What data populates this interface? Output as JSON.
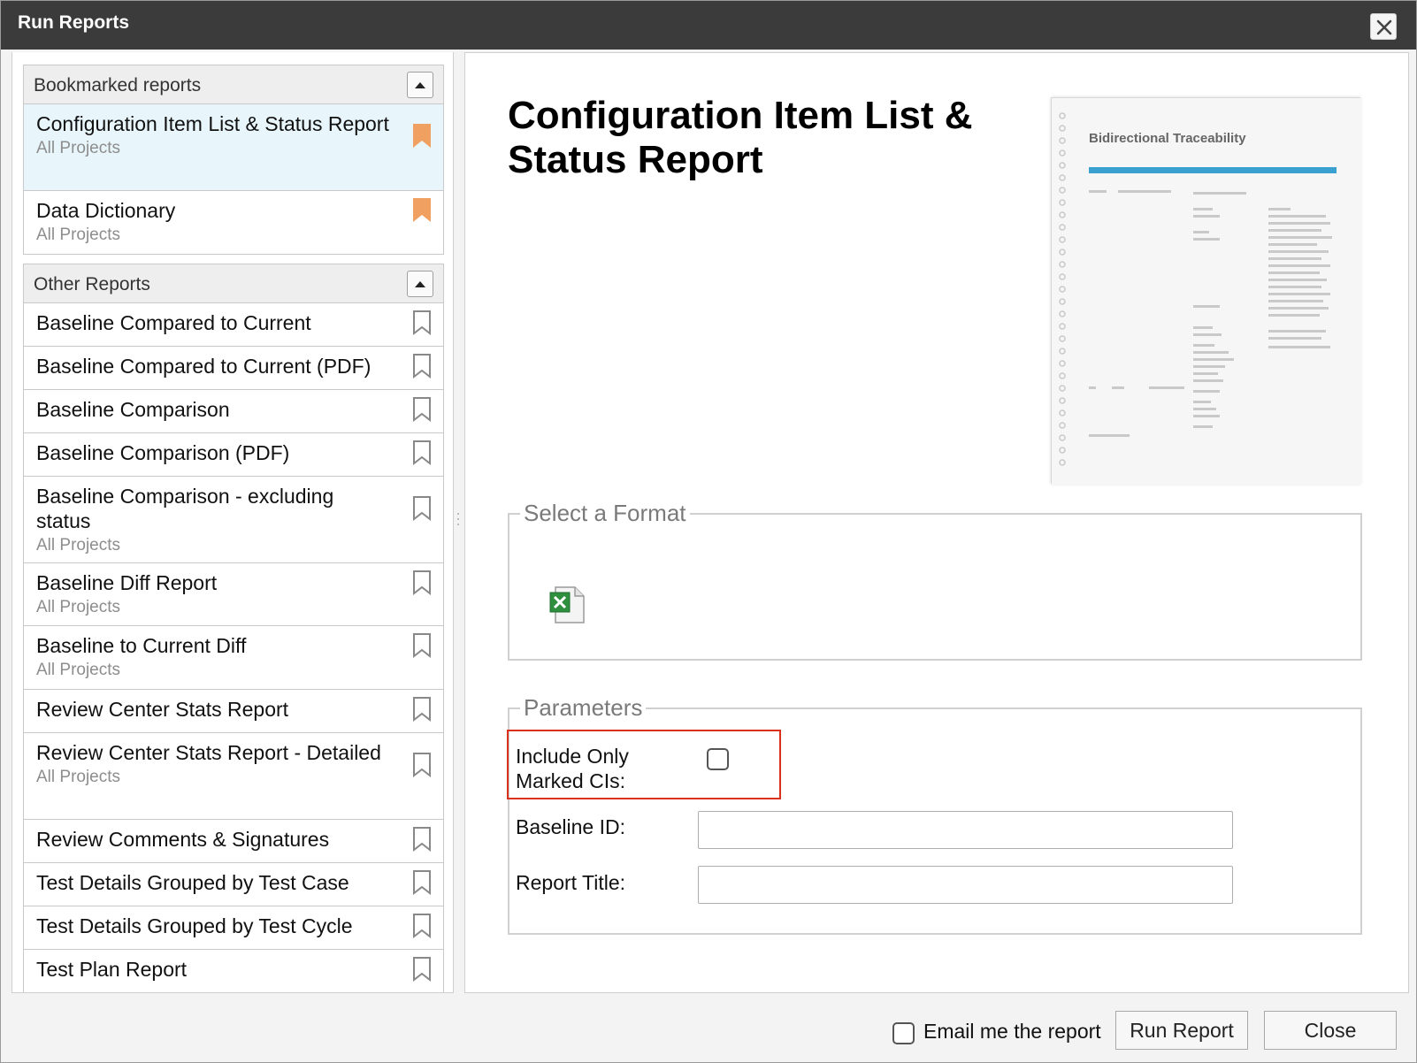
{
  "dialog": {
    "title": "Run Reports"
  },
  "bookmarked": {
    "header": "Bookmarked reports",
    "items": [
      {
        "name": "Configuration Item List & Status Report",
        "sub": "All Projects"
      },
      {
        "name": "Data Dictionary",
        "sub": "All Projects"
      }
    ]
  },
  "other": {
    "header": "Other Reports",
    "items": [
      {
        "name": "Baseline Compared to Current"
      },
      {
        "name": "Baseline Compared to Current (PDF)"
      },
      {
        "name": "Baseline Comparison"
      },
      {
        "name": "Baseline Comparison (PDF)"
      },
      {
        "name": "Baseline Comparison - excluding status",
        "sub": "All Projects"
      },
      {
        "name": "Baseline Diff Report",
        "sub": "All Projects"
      },
      {
        "name": "Baseline to Current Diff",
        "sub": "All Projects"
      },
      {
        "name": "Review Center Stats Report"
      },
      {
        "name": "Review Center Stats Report - Detailed",
        "sub": "All Projects"
      },
      {
        "name": "Review Comments & Signatures"
      },
      {
        "name": "Test Details Grouped by Test Case"
      },
      {
        "name": "Test Details Grouped by Test Cycle"
      },
      {
        "name": "Test Plan Report"
      }
    ]
  },
  "report": {
    "title": "Configuration Item List & Status Report",
    "preview_heading": "Bidirectional Traceability"
  },
  "format": {
    "legend": "Select a Format",
    "icon": "excel-file-icon"
  },
  "parameters": {
    "legend": "Parameters",
    "include_marked_label": "Include Only Marked CIs:",
    "baseline_label": "Baseline ID:",
    "baseline_value": "",
    "title_label": "Report Title:",
    "title_value": ""
  },
  "footer": {
    "email_label": "Email me the report",
    "run_label": "Run Report",
    "close_label": "Close"
  },
  "colors": {
    "bookmark": "#f0a060",
    "selected_bg": "#e8f6fb",
    "highlight": "#d9311c",
    "titlebar": "#3b3b3b"
  }
}
